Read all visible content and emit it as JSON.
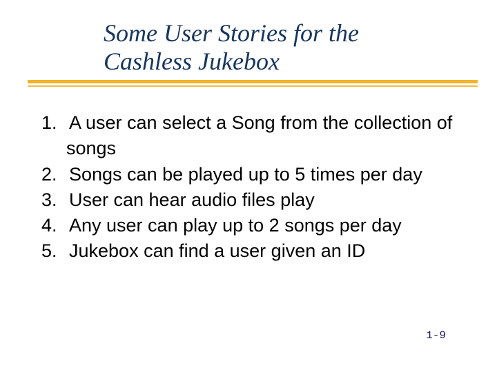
{
  "title": "Some User Stories for the Cashless Jukebox",
  "items": [
    "A user can select a Song from the collection of songs",
    "Songs can be played up to 5 times per day",
    "User can hear audio files play",
    "Any user can play up to 2 songs per day",
    "Jukebox can find a user given an ID"
  ],
  "page_number": "1-9"
}
